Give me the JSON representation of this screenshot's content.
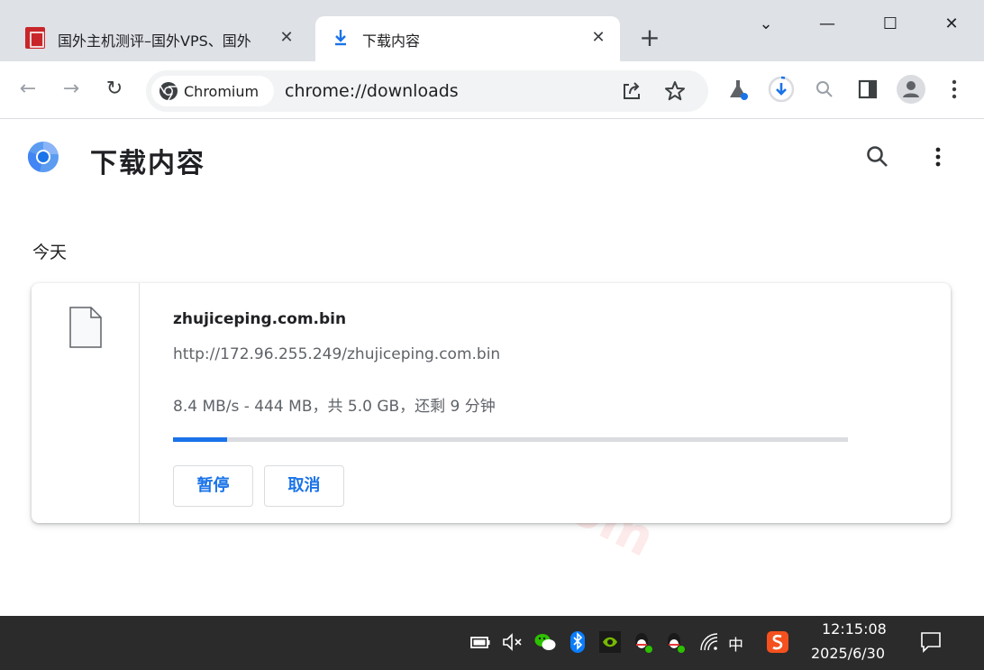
{
  "tabs": [
    {
      "title": "国外主机测评–国外VPS、国外",
      "close": "✕"
    },
    {
      "title": "下载内容",
      "close": "✕"
    }
  ],
  "new_tab": "+",
  "window_controls": {
    "menu": "⌄",
    "minimize": "—",
    "maximize": "☐",
    "close": "✕"
  },
  "toolbar": {
    "back": "←",
    "forward": "→",
    "reload": "↻",
    "chip_label": "Chromium",
    "url": "chrome://downloads"
  },
  "page": {
    "title": "下载内容",
    "date_group": "今天",
    "watermark": "zhujiceping.com"
  },
  "download": {
    "filename": "zhujiceping.com.bin",
    "url": "http://172.96.255.249/zhujiceping.com.bin",
    "status": "8.4 MB/s - 444 MB，共 5.0 GB，还剩 9 分钟",
    "progress": 0.08,
    "pause_label": "暂停",
    "cancel_label": "取消"
  },
  "taskbar": {
    "ime": "中",
    "time": "12:15:08",
    "date": "2025/6/30"
  },
  "colors": {
    "accent": "#1a73e8",
    "tabstrip": "#dee1e6",
    "taskbar": "#2b2b2b"
  }
}
